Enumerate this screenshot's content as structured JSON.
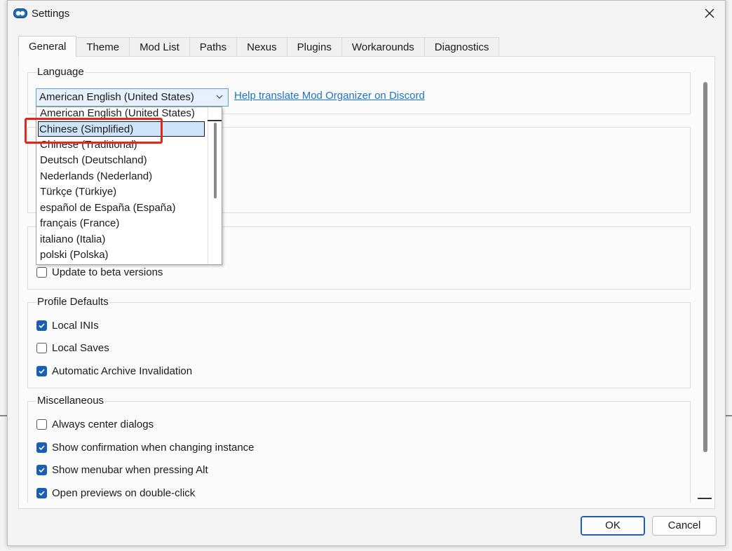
{
  "window": {
    "title": "Settings"
  },
  "tabs": [
    "General",
    "Theme",
    "Mod List",
    "Paths",
    "Nexus",
    "Plugins",
    "Workarounds",
    "Diagnostics"
  ],
  "active_tab": "General",
  "language": {
    "group_title": "Language",
    "selected": "American English (United States)",
    "help_link": "Help translate Mod Organizer on Discord",
    "options": [
      "American English (United States)",
      "Chinese (Simplified)",
      "Chinese (Traditional)",
      "Deutsch (Deutschland)",
      "Nederlands (Nederland)",
      "Türkçe (Türkiye)",
      "español de España (España)",
      "français (France)",
      "italiano (Italia)",
      "polski (Polska)"
    ],
    "highlighted_option": "Chinese (Simplified)"
  },
  "updates": {
    "beta_label": "Update to beta versions",
    "beta_checked": false
  },
  "profile_defaults": {
    "group_title": "Profile Defaults",
    "items": [
      {
        "label": "Local INIs",
        "checked": true
      },
      {
        "label": "Local Saves",
        "checked": false
      },
      {
        "label": "Automatic Archive Invalidation",
        "checked": true
      }
    ]
  },
  "miscellaneous": {
    "group_title": "Miscellaneous",
    "items": [
      {
        "label": "Always center dialogs",
        "checked": false
      },
      {
        "label": "Show confirmation when changing instance",
        "checked": true
      },
      {
        "label": "Show menubar when pressing Alt",
        "checked": true
      },
      {
        "label": "Open previews on double-click",
        "checked": true
      }
    ]
  },
  "buttons": {
    "ok": "OK",
    "cancel": "Cancel"
  },
  "colors": {
    "accent": "#1a5fb4",
    "link": "#1b75c9",
    "highlight_box": "#e0281b"
  }
}
